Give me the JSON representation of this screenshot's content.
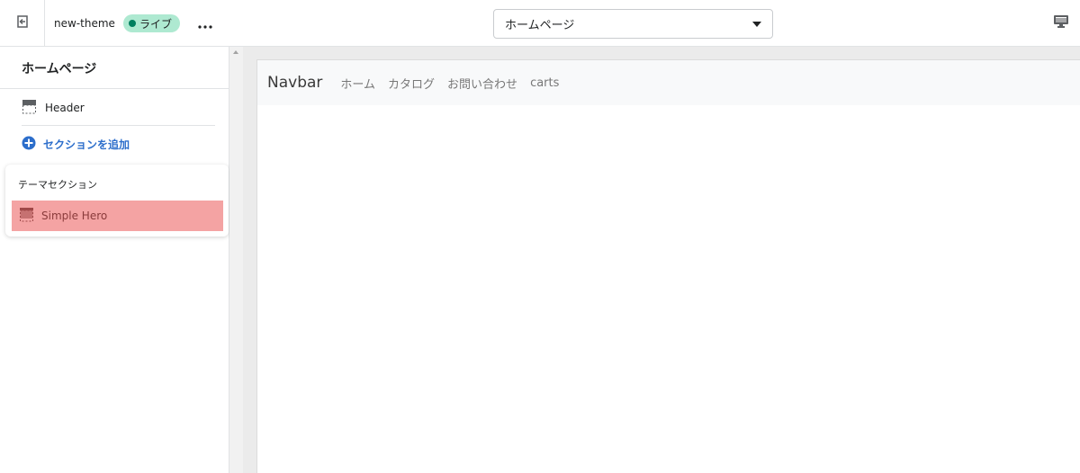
{
  "topbar": {
    "exit_icon": "exit-icon",
    "theme_name": "new-theme",
    "live_badge": "ライブ",
    "more_icon": "more-horizontal-icon",
    "page_select": {
      "value": "ホームページ"
    },
    "device_icon": "desktop-icon"
  },
  "sidebar": {
    "title": "ホームページ",
    "items": [
      {
        "label": "Header",
        "icon": "header-section-icon"
      }
    ],
    "add_section": {
      "label": "セクションを追加",
      "icon": "plus-circle-icon"
    },
    "popover": {
      "title": "テーマセクション",
      "items": [
        {
          "label": "Simple Hero",
          "icon": "section-icon",
          "highlighted": true
        }
      ]
    }
  },
  "preview": {
    "navbar": {
      "brand": "Navbar",
      "links": [
        "ホーム",
        "カタログ",
        "お問い合わせ",
        "carts"
      ]
    }
  },
  "colors": {
    "live_badge_bg": "#aee9d1",
    "live_dot": "#007f5f",
    "add_section_text": "#2c6ecb",
    "highlight_bg": "#f4a3a3"
  }
}
